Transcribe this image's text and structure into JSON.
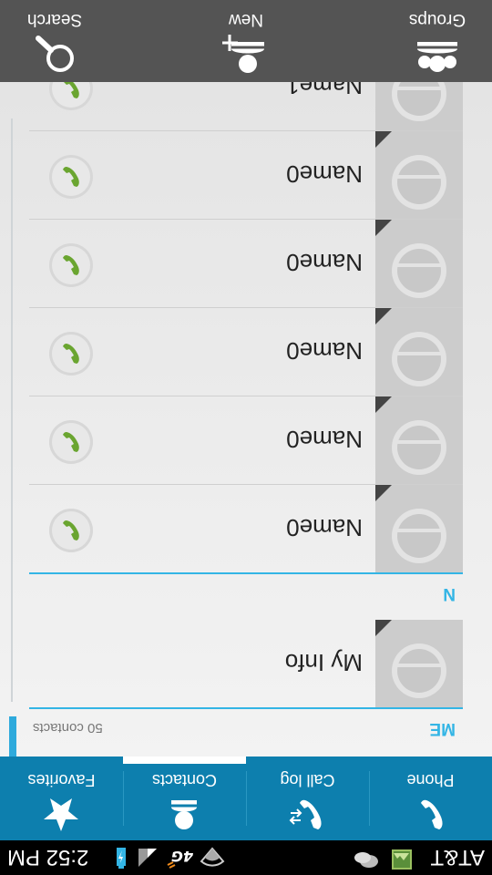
{
  "status_bar": {
    "carrier": "AT&T",
    "time": "2:52 PM",
    "network": "4G"
  },
  "tabs": [
    {
      "label": "Phone",
      "icon": "phone-icon"
    },
    {
      "label": "Call log",
      "icon": "call-log-icon"
    },
    {
      "label": "Contacts",
      "icon": "contacts-icon",
      "selected": true
    },
    {
      "label": "Favorites",
      "icon": "star-icon"
    }
  ],
  "me_section": {
    "title": "ME",
    "count": "50 contacts"
  },
  "my_info": {
    "name": "My Info"
  },
  "n_section": {
    "title": "N"
  },
  "contacts": [
    {
      "name": "Name0"
    },
    {
      "name": "Name0"
    },
    {
      "name": "Name0"
    },
    {
      "name": "Name0"
    },
    {
      "name": "Name0"
    },
    {
      "name": "Name1"
    }
  ],
  "actions": [
    {
      "label": "Groups",
      "icon": "groups-icon"
    },
    {
      "label": "New",
      "icon": "add-contact-icon"
    },
    {
      "label": "Search",
      "icon": "search-icon"
    }
  ],
  "colors": {
    "tab_bar": "#0d7fae",
    "accent": "#33b5e5",
    "action_bar": "#545454",
    "call_green": "#6aa530"
  }
}
